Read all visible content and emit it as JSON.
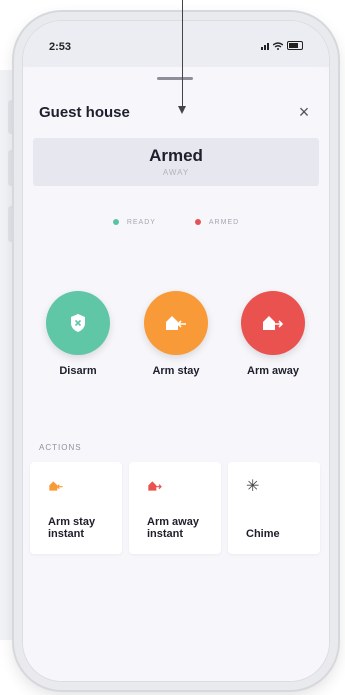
{
  "statusbar": {
    "time": "2:53"
  },
  "sheet": {
    "title": "Guest house",
    "status": {
      "main": "Armed",
      "sub": "AWAY"
    },
    "legend": [
      {
        "label": "READY",
        "color": "#57c3a5"
      },
      {
        "label": "ARMED",
        "color": "#e45157"
      }
    ],
    "arm_buttons": [
      {
        "label": "Disarm",
        "icon": "shield-x-icon",
        "color": "#5fc6a6"
      },
      {
        "label": "Arm stay",
        "icon": "house-arrow-in-icon",
        "color": "#f89a37"
      },
      {
        "label": "Arm away",
        "icon": "house-arrow-out-icon",
        "color": "#e9524f"
      }
    ],
    "actions_label": "ACTIONS",
    "actions": [
      {
        "line1": "Arm stay",
        "line2": "instant",
        "icon": "house-arrow-in-icon",
        "color": "#f89a37"
      },
      {
        "line1": "Arm away",
        "line2": "instant",
        "icon": "house-arrow-out-icon",
        "color": "#e9524f"
      },
      {
        "line1": "Chime",
        "line2": "",
        "icon": "asterisk-icon",
        "color": "#444444"
      }
    ]
  }
}
